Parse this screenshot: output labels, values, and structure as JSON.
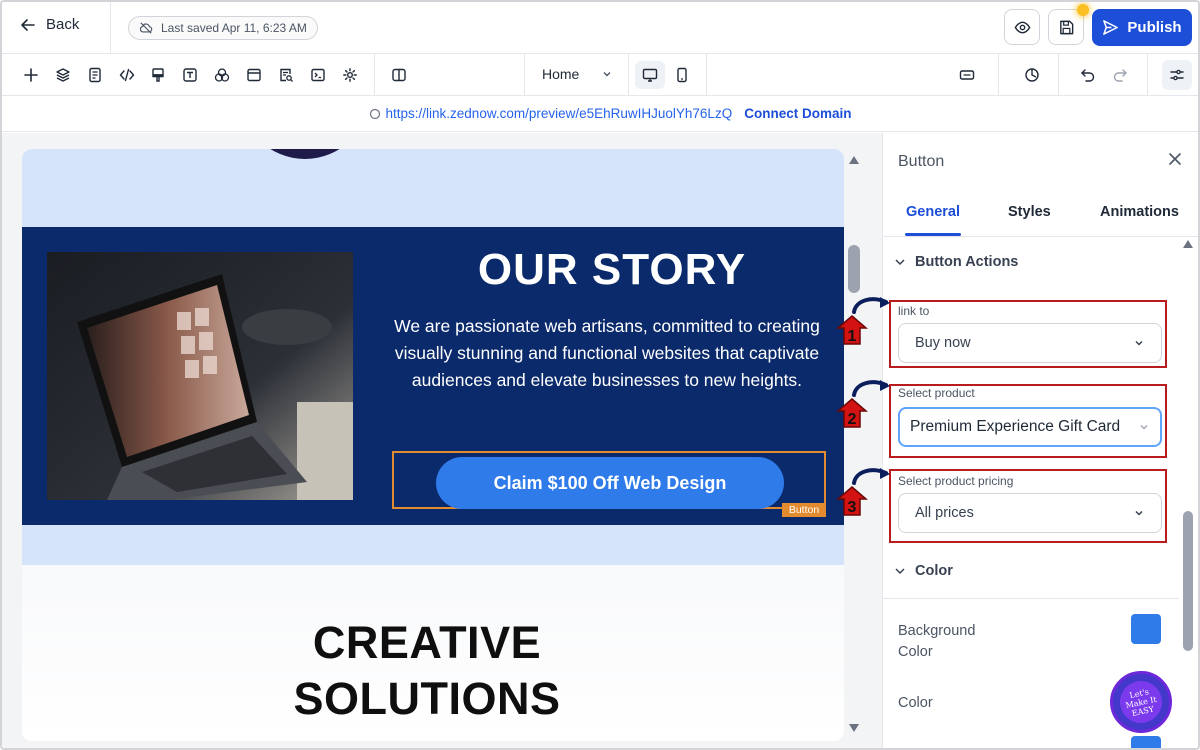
{
  "topbar": {
    "back_label": "Back",
    "saved_text": "Last saved Apr 11, 6:23 AM",
    "publish_label": "Publish"
  },
  "toolbar": {
    "page_select": "Home"
  },
  "urlbar": {
    "url": "https://link.zednow.com/preview/e5EhRuwIHJuolYh76LzQ",
    "connect_label": "Connect Domain"
  },
  "canvas": {
    "story_title": "OUR STORY",
    "story_body": "We are passionate web artisans, committed to creating visually stunning and functional websites that captivate audiences and elevate businesses to new heights.",
    "cta_label": "Claim $100 Off Web Design",
    "selected_tag": "Button",
    "creative_title": "CREATIVE SOLUTIONS"
  },
  "panel": {
    "title": "Button",
    "tabs": [
      "General",
      "Styles",
      "Animations"
    ],
    "active_tab": "General",
    "section_actions": "Button Actions",
    "link_to_label": "link to",
    "link_to_value": "Buy now",
    "product_label": "Select product",
    "product_value": "Premium Experience Gift Card",
    "pricing_label": "Select product pricing",
    "pricing_value": "All prices",
    "section_color": "Color",
    "bg_color_label": "Background Color",
    "color_label": "Color",
    "swatch_color": "#2f7be9"
  },
  "annotations": [
    "1",
    "2",
    "3"
  ],
  "watermark": "Let's Make It EASY"
}
